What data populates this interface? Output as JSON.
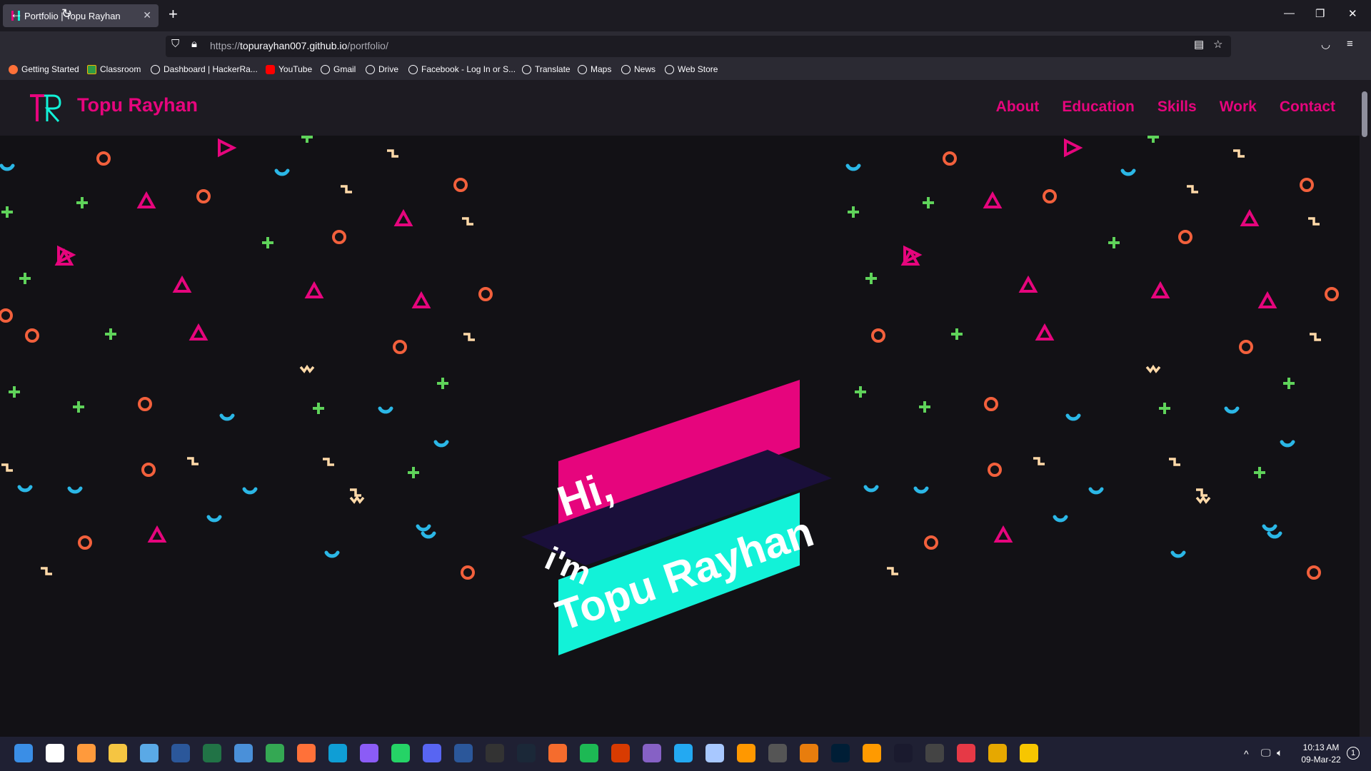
{
  "browser": {
    "tab_title": "Portfolio | Topu Rayhan",
    "new_tab": "+",
    "url_prefix": "https://",
    "url_host": "topurayhan007.github.io",
    "url_path": "/portfolio/",
    "bookmarks": [
      "Getting Started",
      "Classroom",
      "Dashboard | HackerRa...",
      "YouTube",
      "Gmail",
      "Drive",
      "Facebook - Log In or S...",
      "Translate",
      "Maps",
      "News",
      "Web Store"
    ]
  },
  "site": {
    "brand": "Topu Rayhan",
    "nav": [
      "About",
      "Education",
      "Skills",
      "Work",
      "Contact"
    ],
    "hero": {
      "line1": "Hi,",
      "line2": "i'm",
      "line3": "Topu Rayhan"
    },
    "colors": {
      "pink": "#e6057d",
      "teal": "#12f2d8",
      "navy": "#1a0f3a",
      "bg": "#121115"
    }
  },
  "taskbar": {
    "icons": [
      "windows-start-icon",
      "search-icon",
      "everything-search-icon",
      "file-explorer-icon",
      "recycle-bin-icon",
      "word-icon",
      "excel-icon",
      "tiles-app-icon",
      "chrome-icon",
      "firefox-icon",
      "edge-icon",
      "messenger-icon",
      "whatsapp-icon",
      "discord-icon",
      "word-w-icon",
      "epic-games-icon",
      "steam-icon",
      "origin-icon",
      "spotify-icon",
      "office-icon",
      "visual-studio-icon",
      "vscode-icon",
      "virtualbox-icon",
      "sublime-icon",
      "unity-icon",
      "blender-icon",
      "photoshop-icon",
      "illustrator-icon",
      "aftereffects-icon",
      "obs-icon",
      "forza-icon",
      "vectr-icon",
      "rockstar-icon"
    ],
    "time": "10:13 AM",
    "date": "09-Mar-22",
    "notification_count": "1"
  }
}
